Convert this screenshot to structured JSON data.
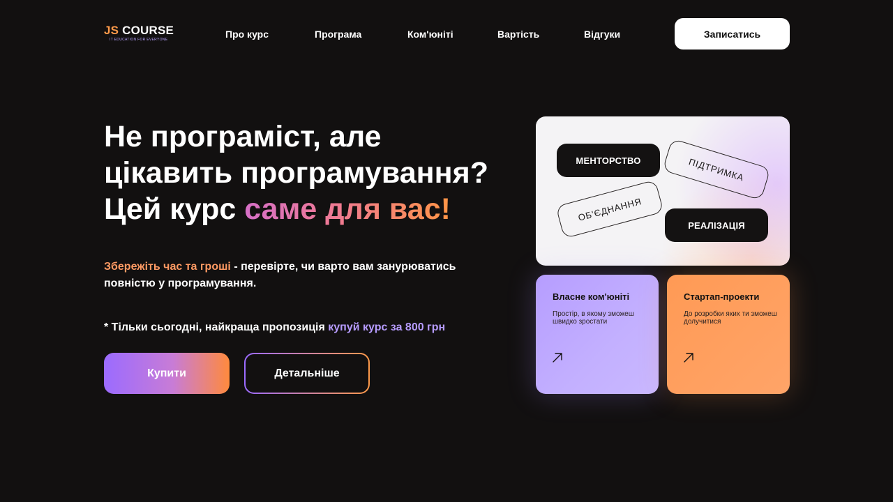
{
  "logo": {
    "js": "JS",
    "course": "COURSE",
    "tagline": "IT EDUCATION FOR EVERYONE"
  },
  "nav": [
    {
      "label": "Про курс"
    },
    {
      "label": "Програма"
    },
    {
      "label": "Ком'юніті"
    },
    {
      "label": "Вартість"
    },
    {
      "label": "Відгуки"
    }
  ],
  "header": {
    "cta_label": "Записатись"
  },
  "hero": {
    "title_line1": "Не програміст, але",
    "title_line2": "цікавить програмування?",
    "title_line3_plain": "Цей курс ",
    "title_line3_accent": "саме для вас!",
    "subtitle_accent": "Збережіть час та гроші",
    "subtitle_rest": " - перевірте, чи варто вам занурюватись повністю у програмування.",
    "offer_plain": "* Тільки сьогодні, найкраща пропозиція ",
    "offer_accent": "купуй курс за 800 грн",
    "buy_label": "Купити",
    "more_label": "Детальніше"
  },
  "tags_card": {
    "tags": [
      "МЕНТОРСТВО",
      "ПІДТРИМКА",
      "ОБ'ЄДНАННЯ",
      "РЕАЛІЗАЦІЯ"
    ]
  },
  "feature_cards": [
    {
      "title": "Власне ком'юніті",
      "text": "Простір, в якому зможеш швидко зростати",
      "icon": "arrow-up-right-icon"
    },
    {
      "title": "Стартап-проекти",
      "text": "До розробки яких ти зможеш долучитися",
      "icon": "arrow-up-right-icon"
    }
  ],
  "colors": {
    "background": "#121010",
    "accent_orange": "#ff9a4a",
    "accent_lilac": "#b79cff",
    "card_purple": "#b69dff",
    "card_orange": "#ff9a55"
  }
}
